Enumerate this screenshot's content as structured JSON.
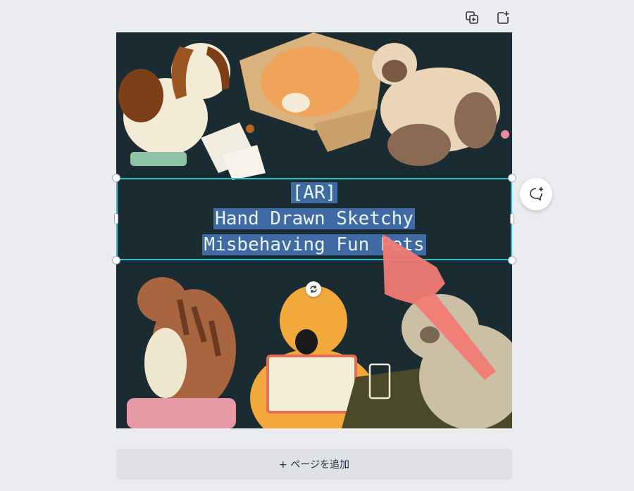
{
  "toolbar": {
    "duplicate_icon": "duplicate-page-icon",
    "add_icon": "add-page-icon"
  },
  "canvas": {
    "background": "#1a2b31",
    "selection_color": "#2cc4cc",
    "highlight_color": "#3f6aa3",
    "text_lines": [
      "[AR]",
      "Hand Drawn Sketchy",
      "Misbehaving Fun Pets"
    ]
  },
  "comment_icon": "add-comment-icon",
  "add_page_label": "+ ページを追加"
}
